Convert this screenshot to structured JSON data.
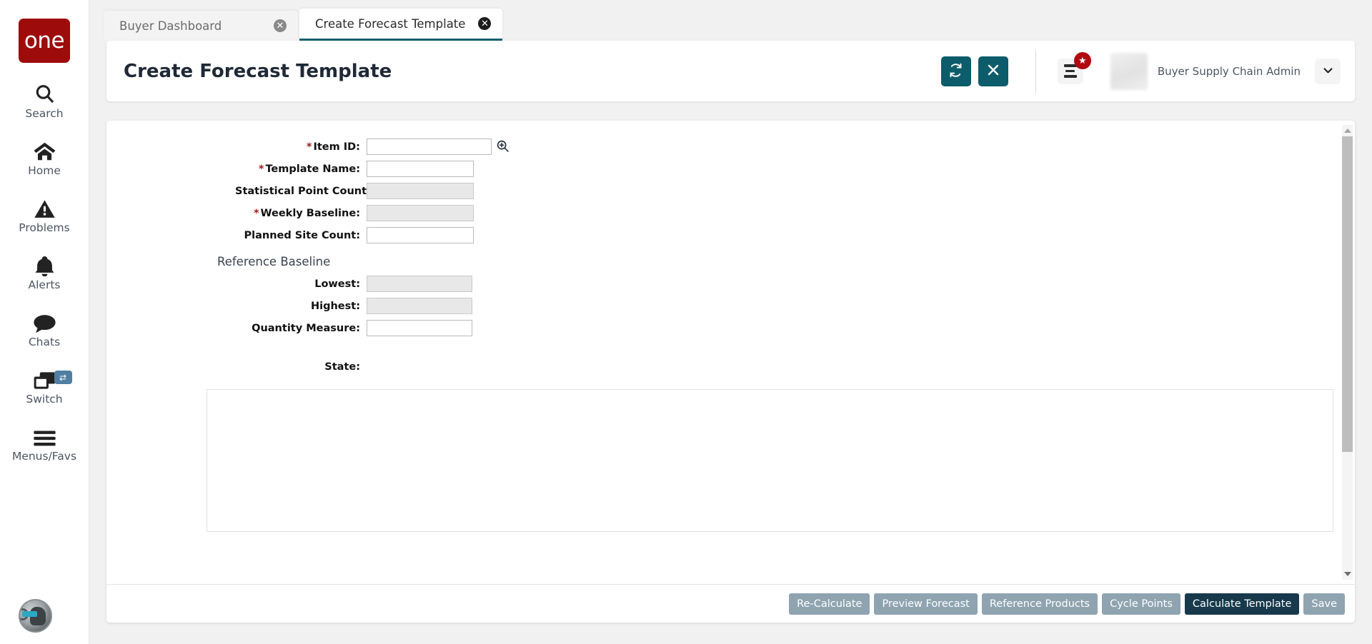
{
  "app": {
    "brand": "one"
  },
  "sidebar": {
    "items": [
      {
        "icon": "search-icon",
        "label": "Search"
      },
      {
        "icon": "home-icon",
        "label": "Home"
      },
      {
        "icon": "warning-icon",
        "label": "Problems"
      },
      {
        "icon": "bell-icon",
        "label": "Alerts"
      },
      {
        "icon": "chat-icon",
        "label": "Chats"
      },
      {
        "icon": "windows-icon",
        "label": "Switch"
      },
      {
        "icon": "hamburger-icon",
        "label": "Menus/Favs"
      }
    ],
    "switch_badge_glyph": "⇄",
    "assistant_avatar": "ai-assistant-avatar"
  },
  "tabs": [
    {
      "label": "Buyer Dashboard",
      "active": false,
      "close_glyph": "✕"
    },
    {
      "label": "Create Forecast Template",
      "active": true,
      "close_glyph": "✕"
    }
  ],
  "header": {
    "title": "Create Forecast Template",
    "refresh_button": "refresh-button",
    "close_button": "close-button",
    "close_glyph": "✕",
    "menu_fav_badge": "★",
    "user": {
      "name": "",
      "role": "Buyer Supply Chain Admin",
      "sub": ""
    },
    "caret_glyph": "⌄"
  },
  "form": {
    "fields": [
      {
        "label": "Item ID:",
        "required": true,
        "readonly": false,
        "width": "w-175",
        "value": "",
        "has_search": true
      },
      {
        "label": "Template Name:",
        "required": true,
        "readonly": false,
        "width": "w-150",
        "value": "",
        "has_search": false
      },
      {
        "label": "Statistical Point Count:",
        "required": false,
        "readonly": true,
        "width": "w-150",
        "value": "",
        "has_search": false
      },
      {
        "label": "Weekly Baseline:",
        "required": true,
        "readonly": true,
        "width": "w-150",
        "value": "",
        "has_search": false
      },
      {
        "label": "Planned Site Count:",
        "required": false,
        "readonly": false,
        "width": "w-150",
        "value": "",
        "has_search": false
      }
    ],
    "section_title": "Reference Baseline",
    "reference_fields": [
      {
        "label": "Lowest:",
        "required": false,
        "readonly": true,
        "width": "w-148",
        "value": ""
      },
      {
        "label": "Highest:",
        "required": false,
        "readonly": true,
        "width": "w-148",
        "value": ""
      },
      {
        "label": "Quantity Measure:",
        "required": false,
        "readonly": false,
        "width": "w-148",
        "value": ""
      }
    ],
    "state_label": "State:",
    "state_value": ""
  },
  "footer": {
    "buttons": [
      {
        "label": "Re-Calculate",
        "primary": false
      },
      {
        "label": "Preview Forecast",
        "primary": false
      },
      {
        "label": "Reference Products",
        "primary": false
      },
      {
        "label": "Cycle Points",
        "primary": false
      },
      {
        "label": "Calculate Template",
        "primary": true
      },
      {
        "label": "Save",
        "primary": false
      }
    ]
  },
  "colors": {
    "brand_red": "#9e0b0b",
    "teal_accent": "#0d5c6b",
    "tab_active_underline": "#14606e",
    "primary_button": "#17394b",
    "secondary_button": "#8fa4b0",
    "badge_red": "#b00710",
    "required_asterisk": "#9e1b1b"
  }
}
